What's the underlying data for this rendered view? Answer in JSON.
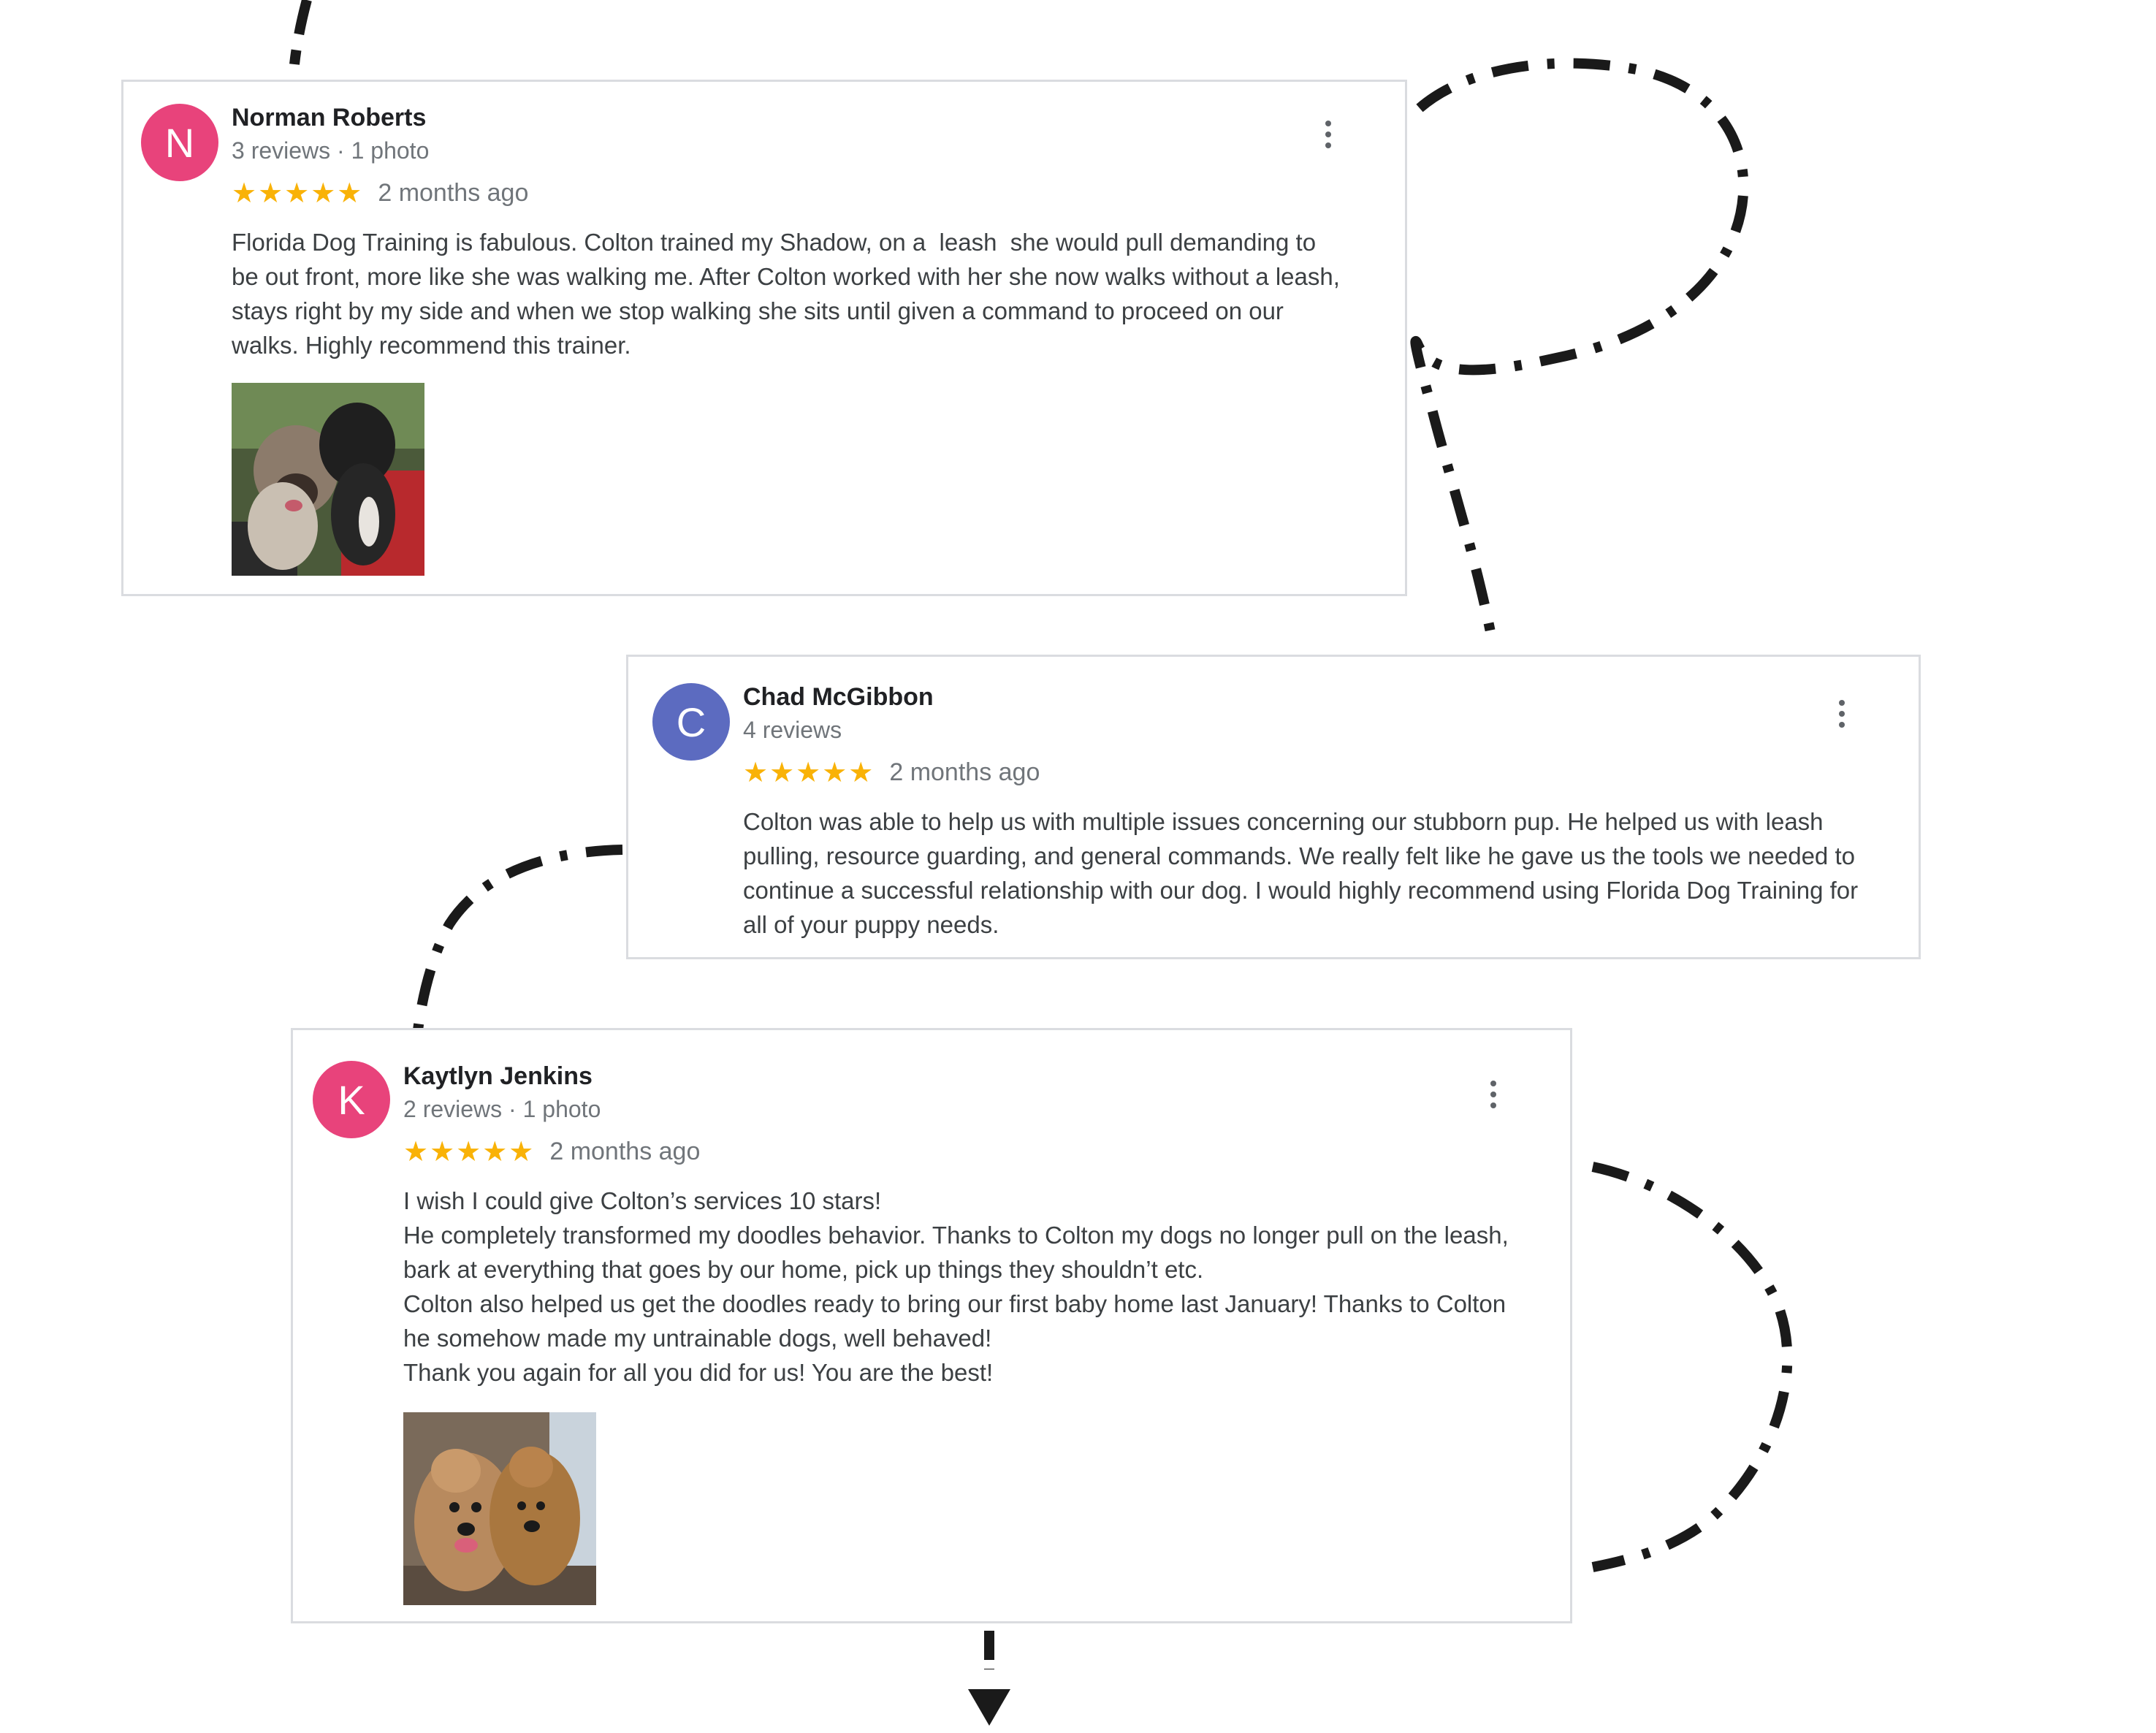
{
  "theme": {
    "star_color": "#f9b207",
    "name_color": "#202124",
    "meta_color": "#70757a",
    "border_color": "#dadce0",
    "path_color": "#1a1a1a"
  },
  "reviews": [
    {
      "avatar_letter": "N",
      "avatar_color": "#e8437b",
      "name": "Norman Roberts",
      "meta": "3 reviews · 1 photo",
      "stars": "★★★★★",
      "rating": 5,
      "date": "2 months ago",
      "text_lines": [
        "Florida Dog Training is fabulous. Colton trained my Shadow, on a  leash  she would pull demanding to",
        "be out front, more like she was walking me. After Colton worked with her she now walks without a leash,",
        "stays right by my side and when we stop walking she sits until given a command to proceed on our",
        "walks. Highly recommend this trainer."
      ],
      "menu_icon": "more-vert-icon",
      "photo_icon": "dog-photo"
    },
    {
      "avatar_letter": "C",
      "avatar_color": "#5c6bc0",
      "name": "Chad McGibbon",
      "meta": "4 reviews",
      "stars": "★★★★★",
      "rating": 5,
      "date": "2 months ago",
      "text_lines": [
        "Colton was able to help us with multiple issues concerning our stubborn pup. He helped us with leash",
        "pulling, resource guarding, and general commands. We really felt like he gave us the tools we needed to",
        "continue a successful relationship with our dog. I would highly recommend using Florida Dog Training for",
        "all of your puppy needs."
      ],
      "menu_icon": "more-vert-icon"
    },
    {
      "avatar_letter": "K",
      "avatar_color": "#e8437b",
      "name": "Kaytlyn Jenkins",
      "meta": "2 reviews · 1 photo",
      "stars": "★★★★★",
      "rating": 5,
      "date": "2 months ago",
      "text_lines": [
        "I wish I could give Colton’s services 10 stars!",
        "He completely transformed my doodles behavior. Thanks to Colton my dogs no longer pull on the leash,",
        "bark at everything that goes by our home, pick up things they shouldn’t etc.",
        "Colton also helped us get the doodles ready to bring our first baby home last January! Thanks to Colton",
        "he somehow made my untrainable dogs, well behaved!",
        "Thank you again for all you did for us! You are the best!"
      ],
      "menu_icon": "more-vert-icon",
      "photo_icon": "doodles-photo"
    }
  ]
}
